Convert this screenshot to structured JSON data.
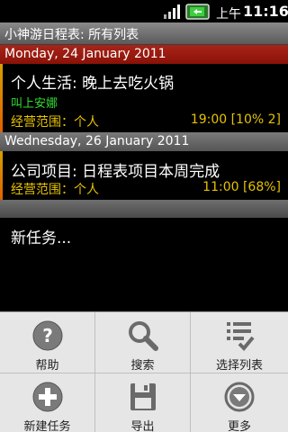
{
  "status_bar": {
    "ampm": "上午",
    "time": "11:16",
    "icons": [
      "signal-icon",
      "battery-icon"
    ]
  },
  "app": {
    "title": "小神游日程表: 所有列表"
  },
  "sections": [
    {
      "date": "Monday, 24 January 2011",
      "color": "#9a1a10",
      "tasks": [
        {
          "title": "个人生活: 晚上去吃火锅",
          "note": "叫上安娜",
          "scope": "经营范围：个人",
          "time": "19:00  [10% 2]"
        }
      ]
    },
    {
      "date": "Wednesday, 26 January 2011",
      "color": "#666666",
      "tasks": [
        {
          "title": "公司项目: 日程表项目本周完成",
          "scope": "经营范围：个人",
          "time": "11:00  [68%]"
        }
      ]
    }
  ],
  "new_task": {
    "label": "新任务..."
  },
  "menu": {
    "items": [
      {
        "label": "帮助",
        "icon": "help-icon"
      },
      {
        "label": "搜索",
        "icon": "search-icon"
      },
      {
        "label": "选择列表",
        "icon": "select-list-icon"
      },
      {
        "label": "新建任务",
        "icon": "add-icon"
      },
      {
        "label": "导出",
        "icon": "save-icon"
      },
      {
        "label": "更多",
        "icon": "more-icon"
      }
    ]
  },
  "colors": {
    "accent_yellow": "#e6c200",
    "note_green": "#33dd33",
    "date_red": "#9a1a10"
  }
}
